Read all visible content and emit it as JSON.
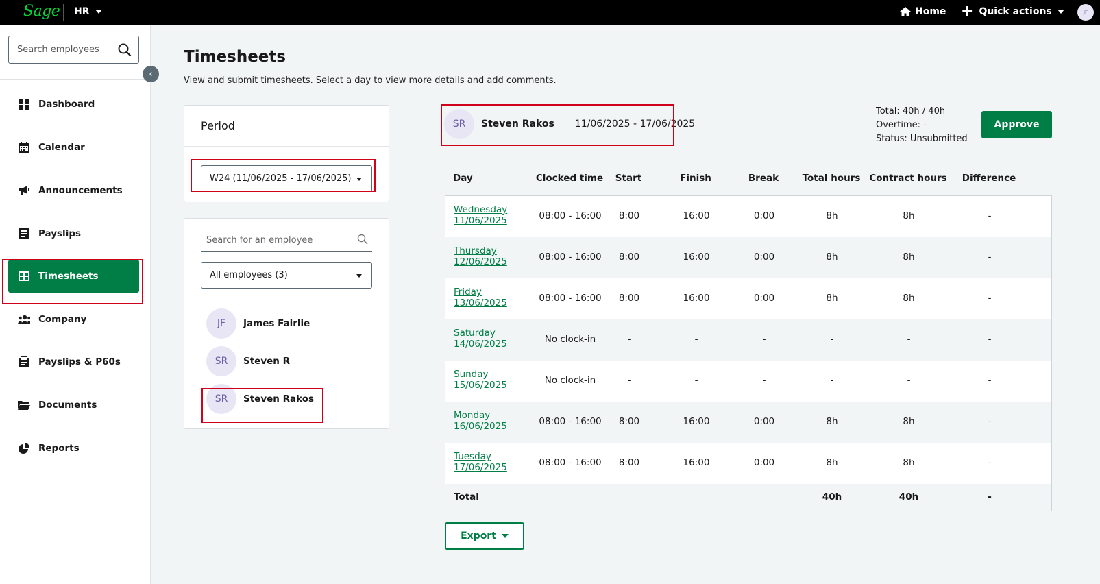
{
  "topbar": {
    "logo": "Sage",
    "app": "HR",
    "home": "Home",
    "quick_actions": "Quick actions",
    "avatar_initials": "JF"
  },
  "sidebar": {
    "search_placeholder": "Search employees",
    "items": [
      {
        "label": "Dashboard",
        "icon": "dashboard-icon"
      },
      {
        "label": "Calendar",
        "icon": "calendar-icon"
      },
      {
        "label": "Announcements",
        "icon": "megaphone-icon"
      },
      {
        "label": "Payslips",
        "icon": "payslip-icon"
      },
      {
        "label": "Timesheets",
        "icon": "timesheet-icon",
        "active": true
      },
      {
        "label": "Company",
        "icon": "people-icon"
      },
      {
        "label": "Payslips & P60s",
        "icon": "payslips-p60-icon"
      },
      {
        "label": "Documents",
        "icon": "folder-icon"
      },
      {
        "label": "Reports",
        "icon": "pie-chart-icon"
      }
    ]
  },
  "page": {
    "title": "Timesheets",
    "subtitle": "View and submit timesheets. Select a day to view more details and add comments."
  },
  "period": {
    "title": "Period",
    "selected": "W24 (11/06/2025 - 17/06/2025)"
  },
  "employees": {
    "search_placeholder": "Search for an employee",
    "filter": "All employees (3)",
    "list": [
      {
        "initials": "JF",
        "name": "James Fairlie"
      },
      {
        "initials": "SR",
        "name": "Steven R"
      },
      {
        "initials": "SR",
        "name": "Steven Rakos"
      }
    ]
  },
  "detail": {
    "initials": "SR",
    "name": "Steven Rakos",
    "range": "11/06/2025 - 17/06/2025",
    "total": "Total: 40h / 40h",
    "overtime": "Overtime: -",
    "status": "Status: Unsubmitted",
    "approve": "Approve"
  },
  "table": {
    "headers": [
      "Day",
      "Clocked time",
      "Start",
      "Finish",
      "Break",
      "Total hours",
      "Contract hours",
      "Difference"
    ],
    "rows": [
      {
        "day": "Wednesday",
        "date": "11/06/2025",
        "clocked": "08:00 - 16:00",
        "start": "8:00",
        "finish": "16:00",
        "break": "0:00",
        "total": "8h",
        "contract": "8h",
        "diff": "-"
      },
      {
        "day": "Thursday",
        "date": "12/06/2025",
        "clocked": "08:00 - 16:00",
        "start": "8:00",
        "finish": "16:00",
        "break": "0:00",
        "total": "8h",
        "contract": "8h",
        "diff": "-"
      },
      {
        "day": "Friday",
        "date": "13/06/2025",
        "clocked": "08:00 - 16:00",
        "start": "8:00",
        "finish": "16:00",
        "break": "0:00",
        "total": "8h",
        "contract": "8h",
        "diff": "-"
      },
      {
        "day": "Saturday",
        "date": "14/06/2025",
        "clocked": "No clock-in",
        "start": "-",
        "finish": "-",
        "break": "-",
        "total": "-",
        "contract": "-",
        "diff": "-"
      },
      {
        "day": "Sunday",
        "date": "15/06/2025",
        "clocked": "No clock-in",
        "start": "-",
        "finish": "-",
        "break": "-",
        "total": "-",
        "contract": "-",
        "diff": "-"
      },
      {
        "day": "Monday",
        "date": "16/06/2025",
        "clocked": "08:00 - 16:00",
        "start": "8:00",
        "finish": "16:00",
        "break": "0:00",
        "total": "8h",
        "contract": "8h",
        "diff": "-"
      },
      {
        "day": "Tuesday",
        "date": "17/06/2025",
        "clocked": "08:00 - 16:00",
        "start": "8:00",
        "finish": "16:00",
        "break": "0:00",
        "total": "8h",
        "contract": "8h",
        "diff": "-"
      }
    ],
    "total_row": {
      "label": "Total",
      "total": "40h",
      "contract": "40h",
      "diff": "-"
    }
  },
  "export": "Export",
  "colors": {
    "brand": "#007e45",
    "highlight": "#d0021b"
  }
}
